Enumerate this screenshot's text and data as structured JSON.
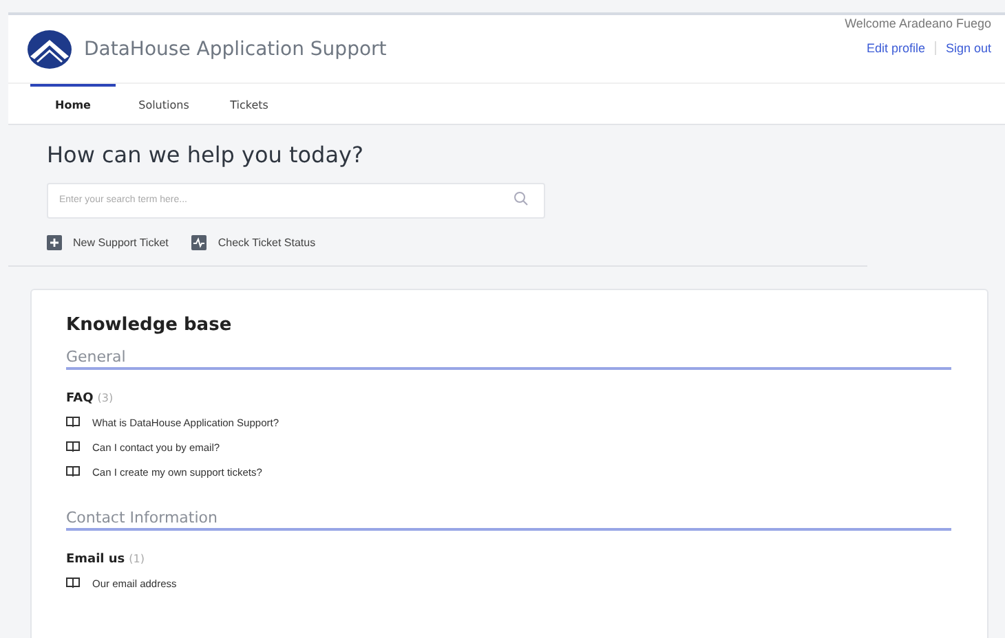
{
  "header": {
    "title": "DataHouse Application Support",
    "welcome": "Welcome Aradeano Fuego",
    "links": [
      "Edit profile",
      "Sign out"
    ]
  },
  "tabs": [
    {
      "label": "Home",
      "selected": true
    },
    {
      "label": "Solutions",
      "selected": false
    },
    {
      "label": "Tickets",
      "selected": false
    }
  ],
  "hero": {
    "heading": "How can we help you today?",
    "search": {
      "placeholder": "Enter your search term here..."
    },
    "actions": [
      {
        "kind": "new",
        "label": "New Support Ticket"
      },
      {
        "kind": "status",
        "label": "Check Ticket Status"
      }
    ]
  },
  "knowledge_base": {
    "title": "Knowledge base",
    "sections": [
      {
        "title": "General",
        "folders": [
          {
            "name": "FAQ",
            "count": "(3)",
            "articles": [
              "What is DataHouse Application Support?",
              "Can I contact you by email?",
              "Can I create my own support tickets?"
            ]
          }
        ]
      },
      {
        "title": "Contact Information",
        "folders": [
          {
            "name": "Email us",
            "count": "(1)",
            "articles": [
              "Our email address"
            ]
          }
        ]
      }
    ]
  }
}
